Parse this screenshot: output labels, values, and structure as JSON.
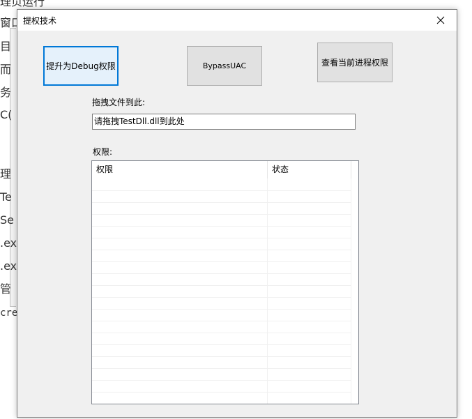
{
  "background_window": {
    "lines": [
      "理页运行",
      "窗口",
      "目",
      "而",
      "务",
      "C(",
      "理",
      "Te",
      "Se",
      ".ex",
      ".ex",
      "管",
      "cre"
    ]
  },
  "dialog": {
    "title": "提权技术",
    "buttons": {
      "debug": "提升为Debug权限",
      "bypass": "BypassUAC",
      "view": "查看当前进程权限"
    },
    "drag_label": "拖拽文件到此:",
    "drag_input": {
      "value": "请拖拽TestDll.dll到此处"
    },
    "priv_label": "权限:",
    "listview": {
      "columns": [
        "权限",
        "状态"
      ],
      "rows": []
    }
  }
}
